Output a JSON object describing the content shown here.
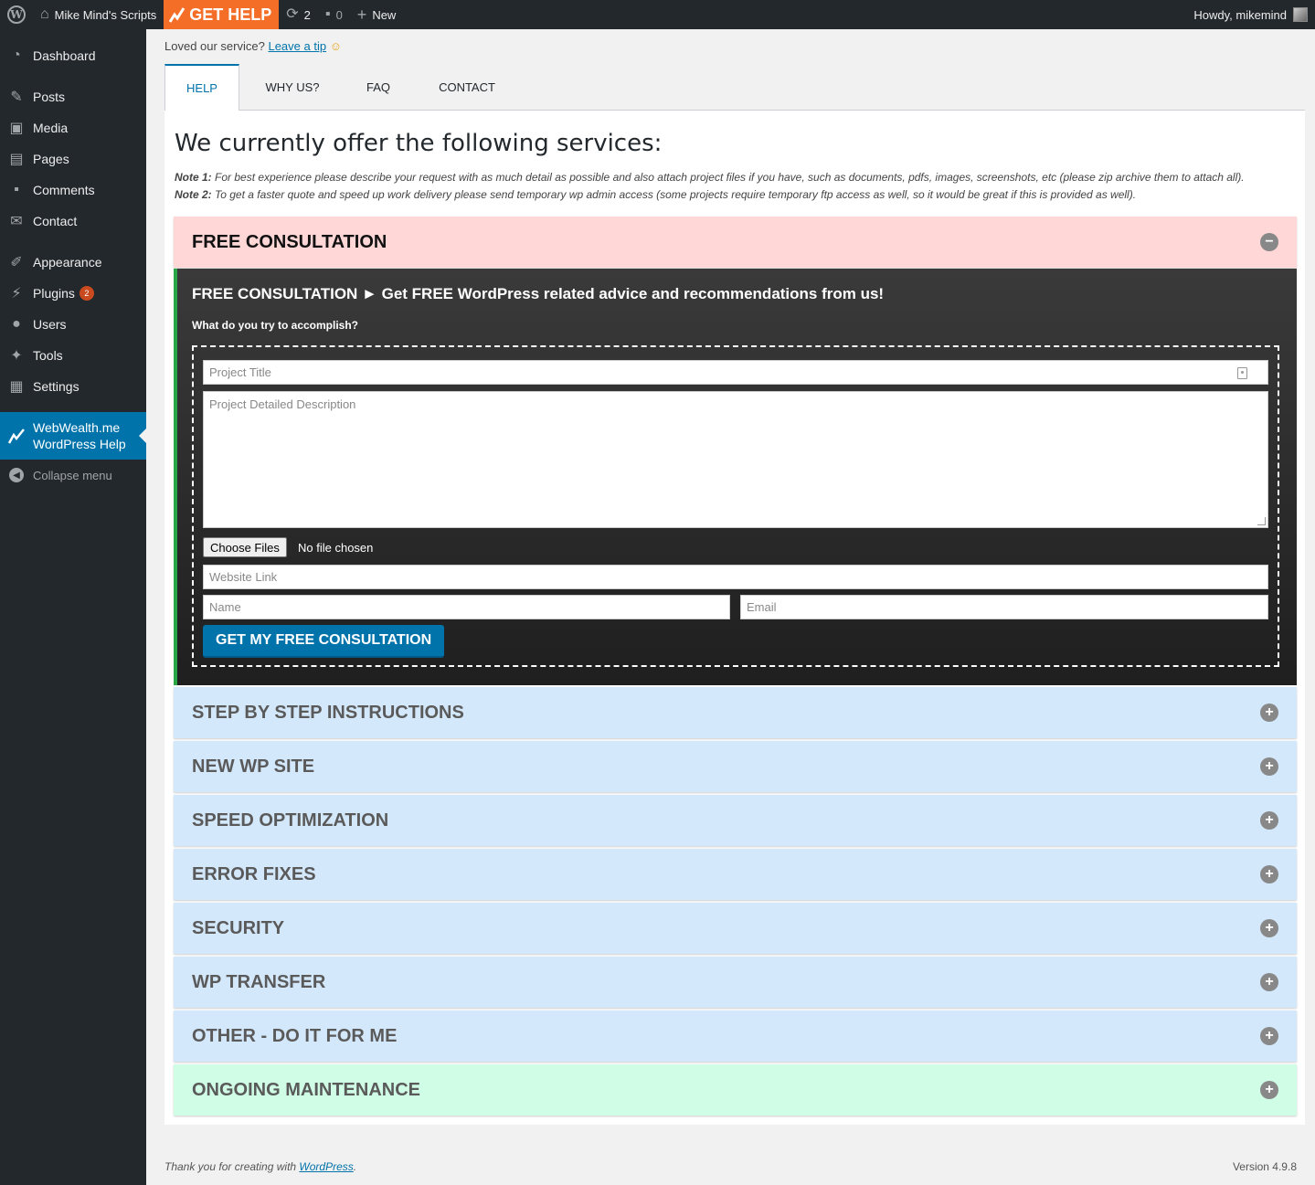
{
  "adminbar": {
    "site_name": "Mike Mind's Scripts",
    "get_help": "GET HELP",
    "updates_count": "2",
    "comments_count": "0",
    "new_label": "New",
    "howdy": "Howdy, mikemind"
  },
  "sidebar": {
    "items": [
      {
        "label": "Dashboard",
        "icon": "dashboard-icon"
      },
      {
        "label": "Posts",
        "icon": "pin-icon"
      },
      {
        "label": "Media",
        "icon": "media-icon"
      },
      {
        "label": "Pages",
        "icon": "pages-icon"
      },
      {
        "label": "Comments",
        "icon": "comment-icon"
      },
      {
        "label": "Contact",
        "icon": "envelope-icon"
      },
      {
        "label": "Appearance",
        "icon": "brush-icon"
      },
      {
        "label": "Plugins",
        "icon": "plug-icon",
        "badge": "2"
      },
      {
        "label": "Users",
        "icon": "user-icon"
      },
      {
        "label": "Tools",
        "icon": "wrench-icon"
      },
      {
        "label": "Settings",
        "icon": "settings-icon"
      }
    ],
    "current_line1": "WebWealth.me",
    "current_line2": "WordPress Help",
    "collapse": "Collapse menu"
  },
  "tipline": {
    "text": "Loved our service?",
    "link": "Leave a tip",
    "emoji": "☺"
  },
  "tabs": [
    "HELP",
    "WHY US?",
    "FAQ",
    "CONTACT"
  ],
  "main": {
    "heading": "We currently offer the following services:",
    "note1_label": "Note 1:",
    "note1_text": " For best experience please describe your request with as much detail as possible and also attach project files if you have, such as documents, pdfs, images, screenshots, etc (please zip archive them to attach all).",
    "note2_label": "Note 2:",
    "note2_text": " To get a faster quote and speed up work delivery please send temporary wp admin access (some projects require temporary ftp access as well, so it would be great if this is provided as well)."
  },
  "consultation": {
    "header": "FREE CONSULTATION",
    "toggle": "−",
    "title": "FREE CONSULTATION ► Get FREE WordPress related advice and recommendations from us!",
    "question": "What do you try to accomplish?",
    "title_placeholder": "Project Title",
    "desc_placeholder": "Project Detailed Description",
    "choose_files": "Choose Files",
    "no_file": "No file chosen",
    "website_placeholder": "Website Link",
    "name_placeholder": "Name",
    "email_placeholder": "Email",
    "submit": "GET MY FREE CONSULTATION"
  },
  "accordion": [
    {
      "label": "STEP BY STEP INSTRUCTIONS",
      "toggle": "+"
    },
    {
      "label": "NEW WP SITE",
      "toggle": "+"
    },
    {
      "label": "SPEED OPTIMIZATION",
      "toggle": "+"
    },
    {
      "label": "ERROR FIXES",
      "toggle": "+"
    },
    {
      "label": "SECURITY",
      "toggle": "+"
    },
    {
      "label": "WP TRANSFER",
      "toggle": "+"
    },
    {
      "label": "OTHER - DO IT FOR ME",
      "toggle": "+"
    },
    {
      "label": "ONGOING MAINTENANCE",
      "toggle": "+"
    }
  ],
  "footer": {
    "thanks": "Thank you for creating with ",
    "link": "WordPress",
    "period": ".",
    "version": "Version 4.9.8"
  },
  "colors": {
    "accent": "#0073aa",
    "get_help": "#f56e28",
    "open_panel": "#ffd7d7",
    "service_blue": "#d4e8fc",
    "maintenance_green": "#d0fde6"
  }
}
